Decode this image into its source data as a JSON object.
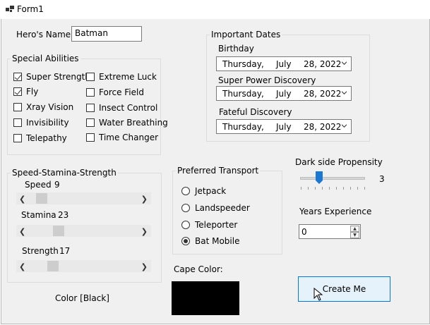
{
  "window": {
    "title": "Form1"
  },
  "hero": {
    "label": "Hero's Name",
    "value": "Batman"
  },
  "abilities": {
    "title": "Special Abilities",
    "items": [
      {
        "label": "Super Strength",
        "checked": true
      },
      {
        "label": "Fly",
        "checked": true
      },
      {
        "label": "Xray Vision",
        "checked": false
      },
      {
        "label": "Invisibility",
        "checked": false
      },
      {
        "label": "Telepathy",
        "checked": false
      },
      {
        "label": "Extreme Luck",
        "checked": false
      },
      {
        "label": "Force Field",
        "checked": false
      },
      {
        "label": "Insect Control",
        "checked": false
      },
      {
        "label": "Water Breathing",
        "checked": false
      },
      {
        "label": "Time Changer",
        "checked": false
      }
    ]
  },
  "dates": {
    "title": "Important Dates",
    "items": [
      {
        "label": "Birthday",
        "day": "Thursday",
        "month": "July",
        "date": "28, 2022"
      },
      {
        "label": "Super Power Discovery",
        "day": "Thursday",
        "month": "July",
        "date": "28, 2022"
      },
      {
        "label": "Fateful Discovery",
        "day": "Thursday",
        "month": "July",
        "date": "28, 2022"
      }
    ],
    "separator": ","
  },
  "stats": {
    "title": "Speed-Stamina-Strength",
    "items": [
      {
        "label": "Speed",
        "value": "9"
      },
      {
        "label": "Stamina",
        "value": "23"
      },
      {
        "label": "Strength",
        "value": "17"
      }
    ]
  },
  "transport": {
    "title": "Preferred Transport",
    "options": [
      {
        "label": "Jetpack",
        "selected": false
      },
      {
        "label": "Landspeeder",
        "selected": false
      },
      {
        "label": "Teleporter",
        "selected": false
      },
      {
        "label": "Bat Mobile",
        "selected": true
      }
    ]
  },
  "darkside": {
    "label": "Dark side Propensity",
    "value": "3"
  },
  "experience": {
    "label": "Years Experience",
    "value": "0"
  },
  "cape": {
    "label": "Cape Color:",
    "color": "#000000"
  },
  "color_label": "Color [Black]",
  "create_button": "Create Me",
  "icons": {
    "app": "app-icon",
    "dropdown": "chevron-down-icon",
    "left": "left-arrow-icon",
    "right": "right-arrow-icon",
    "cursor": "mouse-cursor-icon"
  },
  "colors": {
    "accent": "#0078d7",
    "slider_thumb": "#1978d4",
    "button_bg": "#e5f1fb"
  }
}
